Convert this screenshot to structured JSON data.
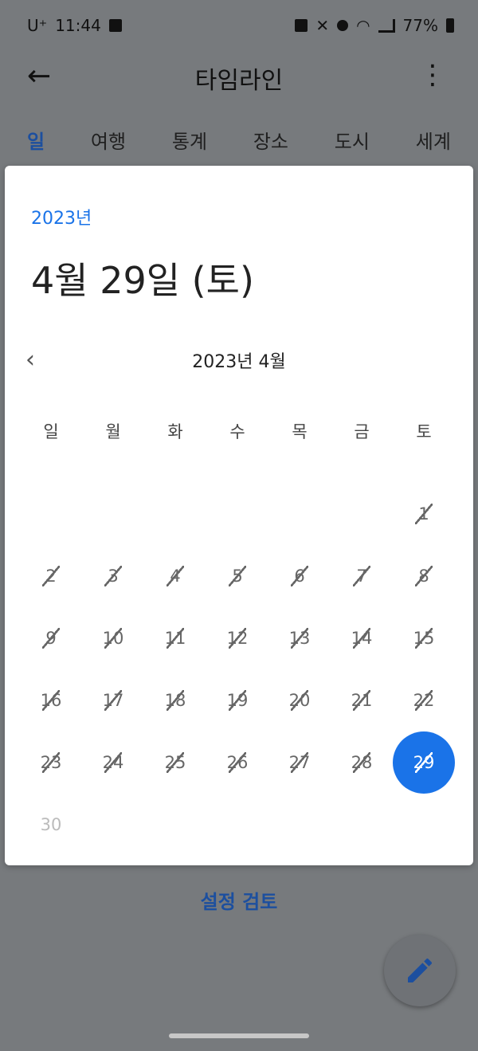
{
  "status": {
    "carrier": "U⁺",
    "time": "11:44",
    "battery": "77%"
  },
  "appbar": {
    "title": "타임라인"
  },
  "tabs": [
    "일",
    "여행",
    "통계",
    "장소",
    "도시",
    "세계"
  ],
  "dialog": {
    "year": "2023년",
    "selected_date": "4월 29일 (토)",
    "month_label": "2023년 4월",
    "weekdays": [
      "일",
      "월",
      "화",
      "수",
      "목",
      "금",
      "토"
    ],
    "weeks": [
      [
        "",
        "",
        "",
        "",
        "",
        "",
        "1"
      ],
      [
        "2",
        "3",
        "4",
        "5",
        "6",
        "7",
        "8"
      ],
      [
        "9",
        "10",
        "11",
        "12",
        "13",
        "14",
        "15"
      ],
      [
        "16",
        "17",
        "18",
        "19",
        "20",
        "21",
        "22"
      ],
      [
        "23",
        "24",
        "25",
        "26",
        "27",
        "28",
        "29"
      ],
      [
        "30",
        "",
        "",
        "",
        "",
        "",
        ""
      ]
    ],
    "selected_day": "29",
    "disabled_days": [
      "30"
    ]
  },
  "footer": {
    "review_label": "설정 검토"
  },
  "colors": {
    "accent": "#1a73e8",
    "scrim": "#777a7d"
  },
  "icons": {
    "back": "arrow-left-icon",
    "more": "more-vert-icon",
    "fab": "pencil-icon",
    "prev": "chevron-left-icon"
  }
}
